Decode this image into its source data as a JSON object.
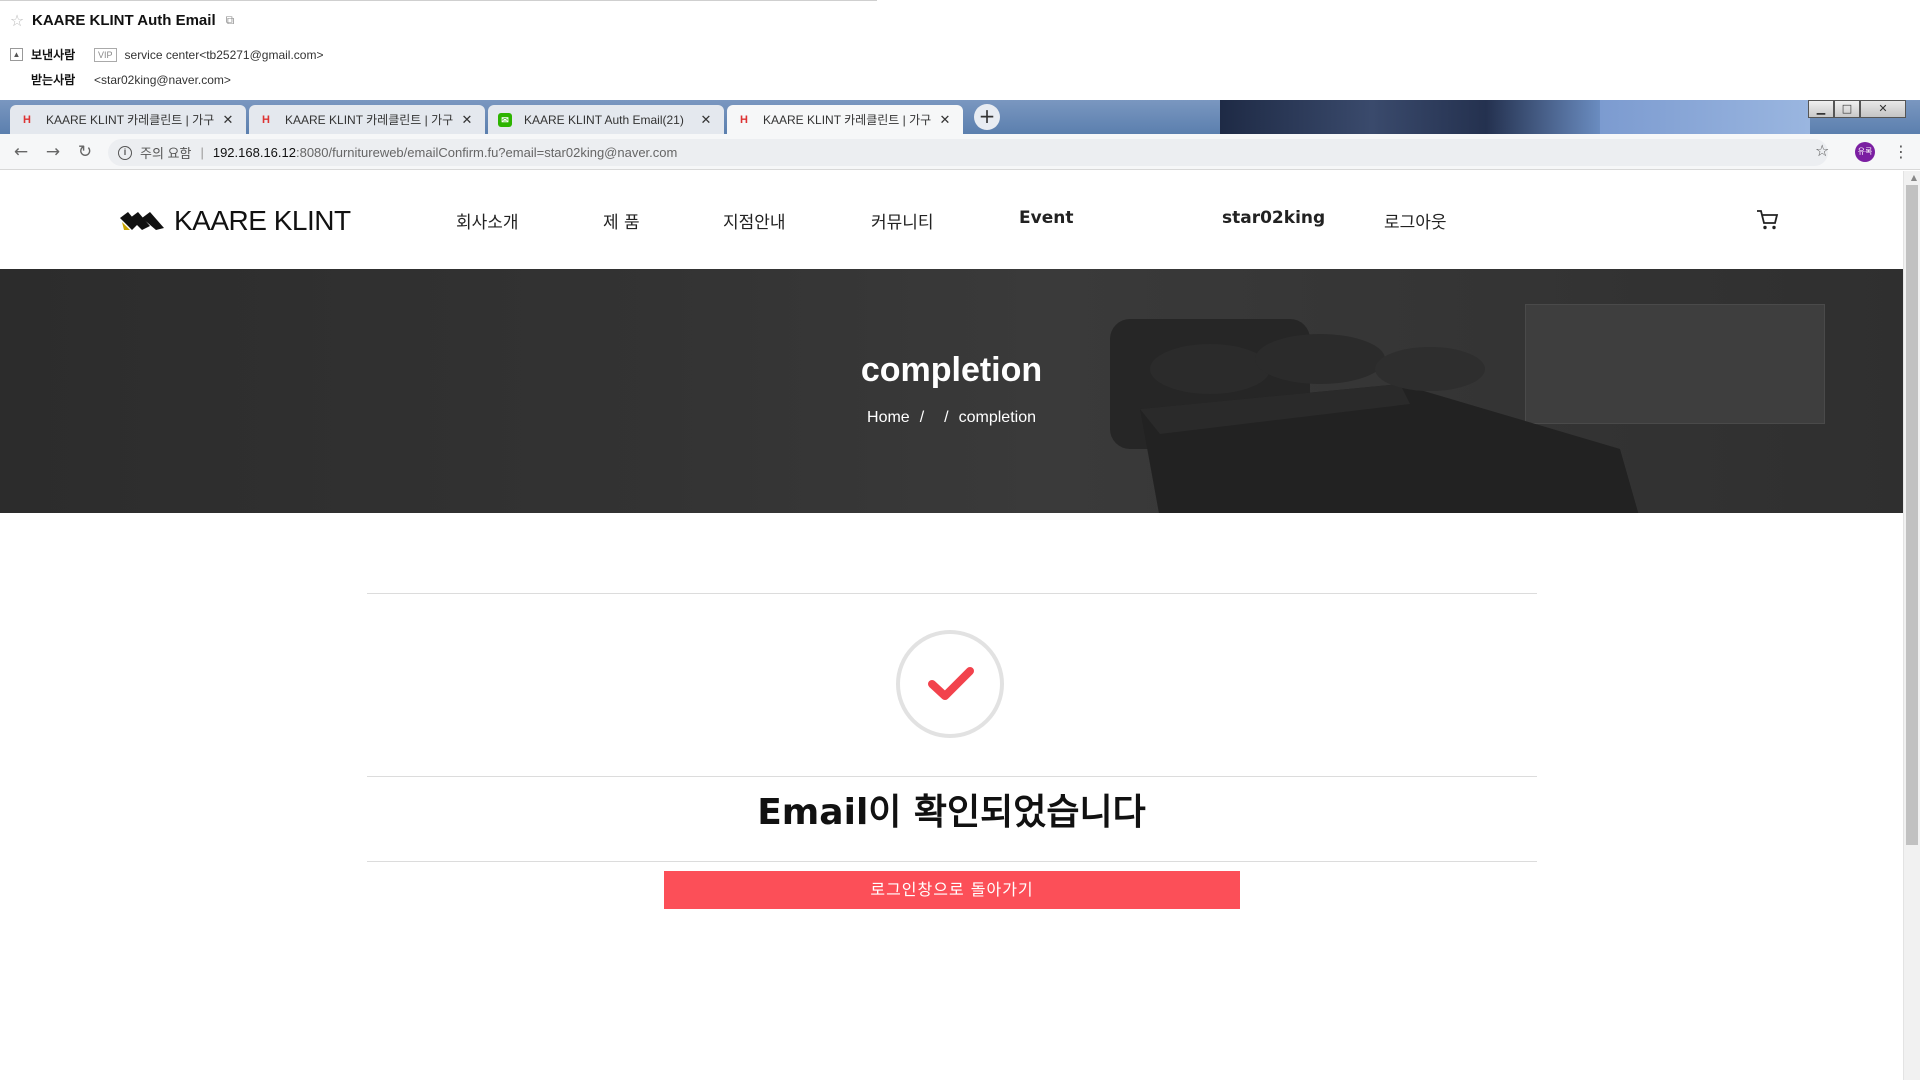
{
  "mail": {
    "subject": "KAARE KLINT Auth Email",
    "from_label": "보낸사람",
    "vip": "VIP",
    "from_address": "service center<tb25271@gmail.com>",
    "to_label": "받는사람",
    "to_address": "<star02king@naver.com>"
  },
  "browser": {
    "tabs": [
      {
        "title": "KAARE KLINT 카레클린트 | 가구"
      },
      {
        "title": "KAARE KLINT 카레클린트 | 가구"
      },
      {
        "title": "KAARE KLINT Auth Email(21)"
      },
      {
        "title": "KAARE KLINT 카레클린트 | 가구"
      }
    ],
    "security_text": "주의 요함",
    "url_host": "192.168.16.12",
    "url_rest": ":8080/furnitureweb/emailConfirm.fu?email=star02king@naver.com",
    "profile_initials": "유록"
  },
  "site": {
    "logo_text": "KAARE KLINT",
    "nav": [
      "회사소개",
      "제 품",
      "지점안내",
      "커뮤니티",
      "Event",
      "star02king",
      "로그아웃"
    ]
  },
  "hero": {
    "title": "completion",
    "breadcrumb_home": "Home",
    "breadcrumb_current": "completion"
  },
  "confirm": {
    "message": "Email이 확인되었습니다",
    "button_label": "로그인창으로 돌아가기"
  },
  "colors": {
    "accent": "#fc4f58",
    "hero_bg": "#333333"
  }
}
